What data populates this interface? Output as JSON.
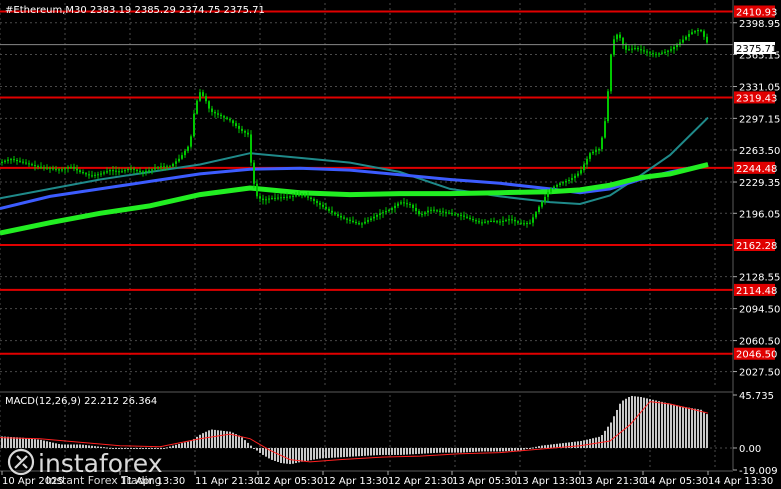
{
  "header": {
    "title": "#Ethereum,M30  2383.19 2385.29 2374.75 2375.71"
  },
  "colors": {
    "background": "#000000",
    "grid": "#4a4a4a",
    "level_line": "#e00000",
    "candle": "#00c800",
    "ma_thick": "#22ee22",
    "ma_blue": "#3c5cff",
    "ma_teal": "#1f8a8a",
    "macd_hist": "#c8c8c8",
    "macd_signal": "#ff2020",
    "axis_text": "#ffffff"
  },
  "price_axis": {
    "ticks": [
      "2398.95",
      "2365.15",
      "2331.05",
      "2297.15",
      "2263.50",
      "2229.35",
      "2196.05",
      "2128.55",
      "2094.50",
      "2060.50",
      "2027.50"
    ],
    "tick_values": [
      2398.95,
      2365.15,
      2331.05,
      2297.15,
      2263.5,
      2229.35,
      2196.05,
      2128.55,
      2094.5,
      2060.5,
      2027.5
    ]
  },
  "levels": [
    {
      "label": "2410.93",
      "value": 2410.93
    },
    {
      "label": "2319.43",
      "value": 2319.43
    },
    {
      "label": "2244.48",
      "value": 2244.48
    },
    {
      "label": "2162.28",
      "value": 2162.28
    },
    {
      "label": "2114.48",
      "value": 2114.48
    },
    {
      "label": "2046.50",
      "value": 2046.5
    }
  ],
  "current_price": {
    "label": "2375.71",
    "value": 2375.71
  },
  "time_axis": {
    "labels": [
      "10 Apr 2025",
      "11 Apr 13:30",
      "11 Apr 21:30",
      "12 Apr 05:30",
      "12 Apr 13:30",
      "12 Apr 21:30",
      "13 Apr 05:30",
      "13 Apr 13:30",
      "13 Apr 21:30",
      "14 Apr 05:30",
      "14 Apr 13:30"
    ]
  },
  "macd": {
    "label": "MACD(12,26,9) 22.212 26.364",
    "ticks": [
      "45.735",
      "0.00",
      "-19.009"
    ]
  },
  "watermark": {
    "brand": "instaforex",
    "tagline": "Instant Forex Trading"
  },
  "chart_data": {
    "type": "candlestick",
    "symbol": "#Ethereum",
    "timeframe": "M30",
    "ohlc_last": {
      "open": 2383.19,
      "high": 2385.29,
      "low": 2374.75,
      "close": 2375.71
    },
    "ylim": [
      2010,
      2420
    ],
    "close_path": [
      [
        0,
        2250
      ],
      [
        10,
        2254
      ],
      [
        20,
        2251
      ],
      [
        30,
        2248
      ],
      [
        40,
        2245
      ],
      [
        50,
        2244
      ],
      [
        60,
        2242
      ],
      [
        70,
        2246
      ],
      [
        80,
        2240
      ],
      [
        90,
        2236
      ],
      [
        100,
        2238
      ],
      [
        110,
        2242
      ],
      [
        120,
        2240
      ],
      [
        130,
        2244
      ],
      [
        140,
        2240
      ],
      [
        150,
        2242
      ],
      [
        160,
        2246
      ],
      [
        170,
        2246
      ],
      [
        180,
        2255
      ],
      [
        190,
        2270
      ],
      [
        195,
        2310
      ],
      [
        200,
        2325
      ],
      [
        205,
        2318
      ],
      [
        210,
        2305
      ],
      [
        220,
        2300
      ],
      [
        230,
        2295
      ],
      [
        240,
        2285
      ],
      [
        248,
        2280
      ],
      [
        252,
        2240
      ],
      [
        256,
        2215
      ],
      [
        262,
        2210
      ],
      [
        270,
        2212
      ],
      [
        280,
        2213
      ],
      [
        290,
        2214
      ],
      [
        300,
        2216
      ],
      [
        310,
        2212
      ],
      [
        320,
        2205
      ],
      [
        330,
        2198
      ],
      [
        340,
        2192
      ],
      [
        350,
        2188
      ],
      [
        360,
        2184
      ],
      [
        370,
        2190
      ],
      [
        380,
        2196
      ],
      [
        390,
        2200
      ],
      [
        400,
        2208
      ],
      [
        410,
        2205
      ],
      [
        420,
        2194
      ],
      [
        430,
        2200
      ],
      [
        440,
        2198
      ],
      [
        450,
        2196
      ],
      [
        460,
        2194
      ],
      [
        470,
        2190
      ],
      [
        480,
        2186
      ],
      [
        490,
        2188
      ],
      [
        500,
        2187
      ],
      [
        510,
        2190
      ],
      [
        520,
        2185
      ],
      [
        530,
        2186
      ],
      [
        540,
        2205
      ],
      [
        550,
        2222
      ],
      [
        560,
        2228
      ],
      [
        570,
        2232
      ],
      [
        580,
        2240
      ],
      [
        590,
        2260
      ],
      [
        600,
        2265
      ],
      [
        606,
        2300
      ],
      [
        612,
        2378
      ],
      [
        618,
        2388
      ],
      [
        625,
        2370
      ],
      [
        635,
        2372
      ],
      [
        645,
        2368
      ],
      [
        655,
        2365
      ],
      [
        665,
        2368
      ],
      [
        670,
        2370
      ],
      [
        680,
        2378
      ],
      [
        690,
        2388
      ],
      [
        700,
        2392
      ],
      [
        708,
        2376
      ]
    ],
    "ma_fast_path": [
      [
        0,
        2175
      ],
      [
        50,
        2186
      ],
      [
        100,
        2196
      ],
      [
        150,
        2204
      ],
      [
        200,
        2216
      ],
      [
        250,
        2223
      ],
      [
        300,
        2218
      ],
      [
        350,
        2216
      ],
      [
        400,
        2217
      ],
      [
        450,
        2217
      ],
      [
        500,
        2218
      ],
      [
        550,
        2219
      ],
      [
        580,
        2221
      ],
      [
        610,
        2226
      ],
      [
        640,
        2234
      ],
      [
        670,
        2238
      ],
      [
        708,
        2248
      ]
    ],
    "ma_mid_path": [
      [
        0,
        2201
      ],
      [
        50,
        2214
      ],
      [
        100,
        2222
      ],
      [
        150,
        2230
      ],
      [
        200,
        2238
      ],
      [
        250,
        2243
      ],
      [
        300,
        2244
      ],
      [
        350,
        2242
      ],
      [
        400,
        2237
      ],
      [
        450,
        2232
      ],
      [
        500,
        2228
      ],
      [
        550,
        2222
      ],
      [
        580,
        2218
      ],
      [
        610,
        2222
      ],
      [
        640,
        2232
      ],
      [
        670,
        2240
      ],
      [
        708,
        2248
      ]
    ],
    "ma_slow_path": [
      [
        0,
        2212
      ],
      [
        50,
        2222
      ],
      [
        100,
        2232
      ],
      [
        150,
        2240
      ],
      [
        200,
        2248
      ],
      [
        250,
        2260
      ],
      [
        300,
        2255
      ],
      [
        350,
        2250
      ],
      [
        400,
        2240
      ],
      [
        450,
        2222
      ],
      [
        500,
        2214
      ],
      [
        550,
        2208
      ],
      [
        580,
        2206
      ],
      [
        610,
        2215
      ],
      [
        640,
        2236
      ],
      [
        670,
        2258
      ],
      [
        708,
        2298
      ]
    ],
    "macd_series": {
      "ylim": [
        -19.009,
        45.735
      ],
      "histogram_path": [
        [
          0,
          10
        ],
        [
          20,
          9
        ],
        [
          40,
          7
        ],
        [
          60,
          3
        ],
        [
          80,
          3
        ],
        [
          100,
          1
        ],
        [
          120,
          -1
        ],
        [
          140,
          0
        ],
        [
          160,
          -1
        ],
        [
          180,
          4
        ],
        [
          190,
          6
        ],
        [
          200,
          12
        ],
        [
          210,
          16
        ],
        [
          220,
          15
        ],
        [
          230,
          14
        ],
        [
          240,
          10
        ],
        [
          250,
          2
        ],
        [
          260,
          -5
        ],
        [
          270,
          -10
        ],
        [
          280,
          -13
        ],
        [
          290,
          -14
        ],
        [
          300,
          -12
        ],
        [
          320,
          -9
        ],
        [
          340,
          -8
        ],
        [
          360,
          -7
        ],
        [
          380,
          -6
        ],
        [
          400,
          -6
        ],
        [
          420,
          -5
        ],
        [
          440,
          -4
        ],
        [
          460,
          -4
        ],
        [
          480,
          -3
        ],
        [
          500,
          -3
        ],
        [
          520,
          -2
        ],
        [
          540,
          2
        ],
        [
          560,
          4
        ],
        [
          580,
          6
        ],
        [
          600,
          10
        ],
        [
          610,
          22
        ],
        [
          620,
          40
        ],
        [
          630,
          45
        ],
        [
          640,
          44
        ],
        [
          660,
          40
        ],
        [
          680,
          36
        ],
        [
          700,
          33
        ],
        [
          708,
          28
        ]
      ],
      "signal_path": [
        [
          0,
          9
        ],
        [
          40,
          8
        ],
        [
          80,
          5
        ],
        [
          120,
          2
        ],
        [
          160,
          1
        ],
        [
          200,
          8
        ],
        [
          230,
          12
        ],
        [
          250,
          8
        ],
        [
          270,
          -2
        ],
        [
          290,
          -10
        ],
        [
          310,
          -12
        ],
        [
          340,
          -10
        ],
        [
          380,
          -8
        ],
        [
          420,
          -7
        ],
        [
          460,
          -5
        ],
        [
          500,
          -4
        ],
        [
          540,
          -1
        ],
        [
          580,
          2
        ],
        [
          610,
          6
        ],
        [
          630,
          20
        ],
        [
          650,
          40
        ],
        [
          670,
          38
        ],
        [
          690,
          34
        ],
        [
          708,
          30
        ]
      ]
    }
  }
}
